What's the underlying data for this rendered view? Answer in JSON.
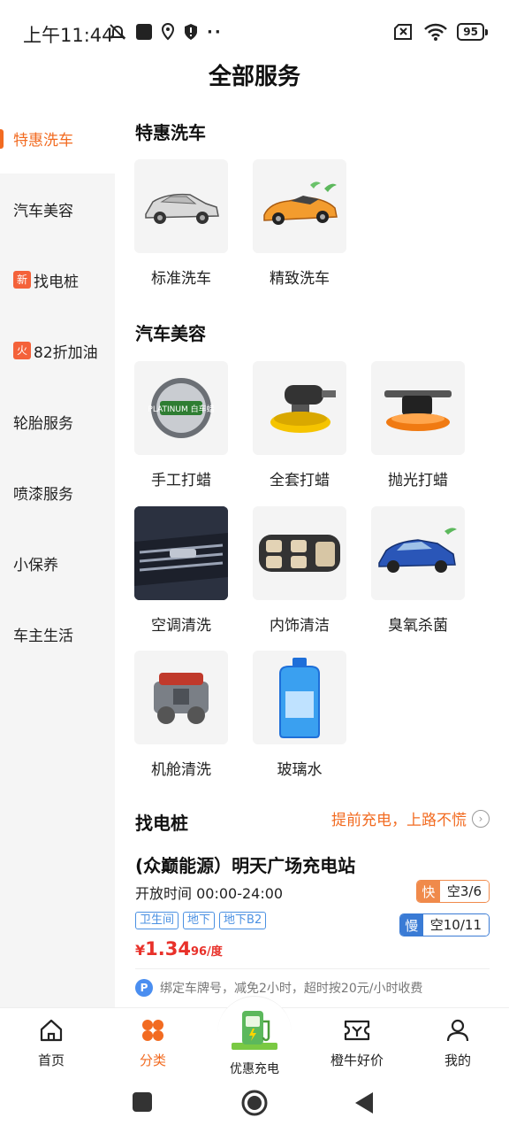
{
  "status_bar": {
    "time": "上午11:44",
    "battery": "95"
  },
  "page_title": "全部服务",
  "sidebar": {
    "items": [
      {
        "label": "特惠洗车",
        "badge": "",
        "active": true
      },
      {
        "label": "汽车美容",
        "badge": ""
      },
      {
        "label": "找电桩",
        "badge": "新"
      },
      {
        "label": "82折加油",
        "badge": "火"
      },
      {
        "label": "轮胎服务",
        "badge": ""
      },
      {
        "label": "喷漆服务",
        "badge": ""
      },
      {
        "label": "小保养",
        "badge": ""
      },
      {
        "label": "车主生活",
        "badge": ""
      }
    ]
  },
  "sections": {
    "car_wash": {
      "title": "特惠洗车",
      "items": [
        "标准洗车",
        "精致洗车"
      ]
    },
    "car_beauty": {
      "title": "汽车美容",
      "items": [
        "手工打蜡",
        "全套打蜡",
        "抛光打蜡",
        "空调清洗",
        "内饰清洁",
        "臭氧杀菌",
        "机舱清洗",
        "玻璃水"
      ]
    },
    "charging": {
      "title": "找电桩",
      "link": "提前充电，上路不慌",
      "station": {
        "name": "(众巅能源）明天广场充电站",
        "hours": "开放时间 00:00-24:00",
        "tags": [
          "卫生间",
          "地下",
          "地下B2"
        ],
        "price_symbol": "¥",
        "price_value": "1.34",
        "price_extra": "96/度",
        "fast_kind": "快",
        "fast_avail": "空3/6",
        "slow_kind": "慢",
        "slow_avail": "空10/11",
        "parking_note": "绑定车牌号，减免2小时，超时按20元/小时收费",
        "parking_icon": "P"
      }
    }
  },
  "product_image_text": "PLATINUM 白车蜡",
  "bottom_nav": {
    "home": "首页",
    "category": "分类",
    "charge": "优惠充电",
    "deals": "橙牛好价",
    "mine": "我的"
  },
  "colors": {
    "accent": "#f26b21",
    "price": "#e8312a",
    "tag_blue": "#4a90e2",
    "fast": "#f08a4b",
    "slow": "#3a7bd5"
  }
}
